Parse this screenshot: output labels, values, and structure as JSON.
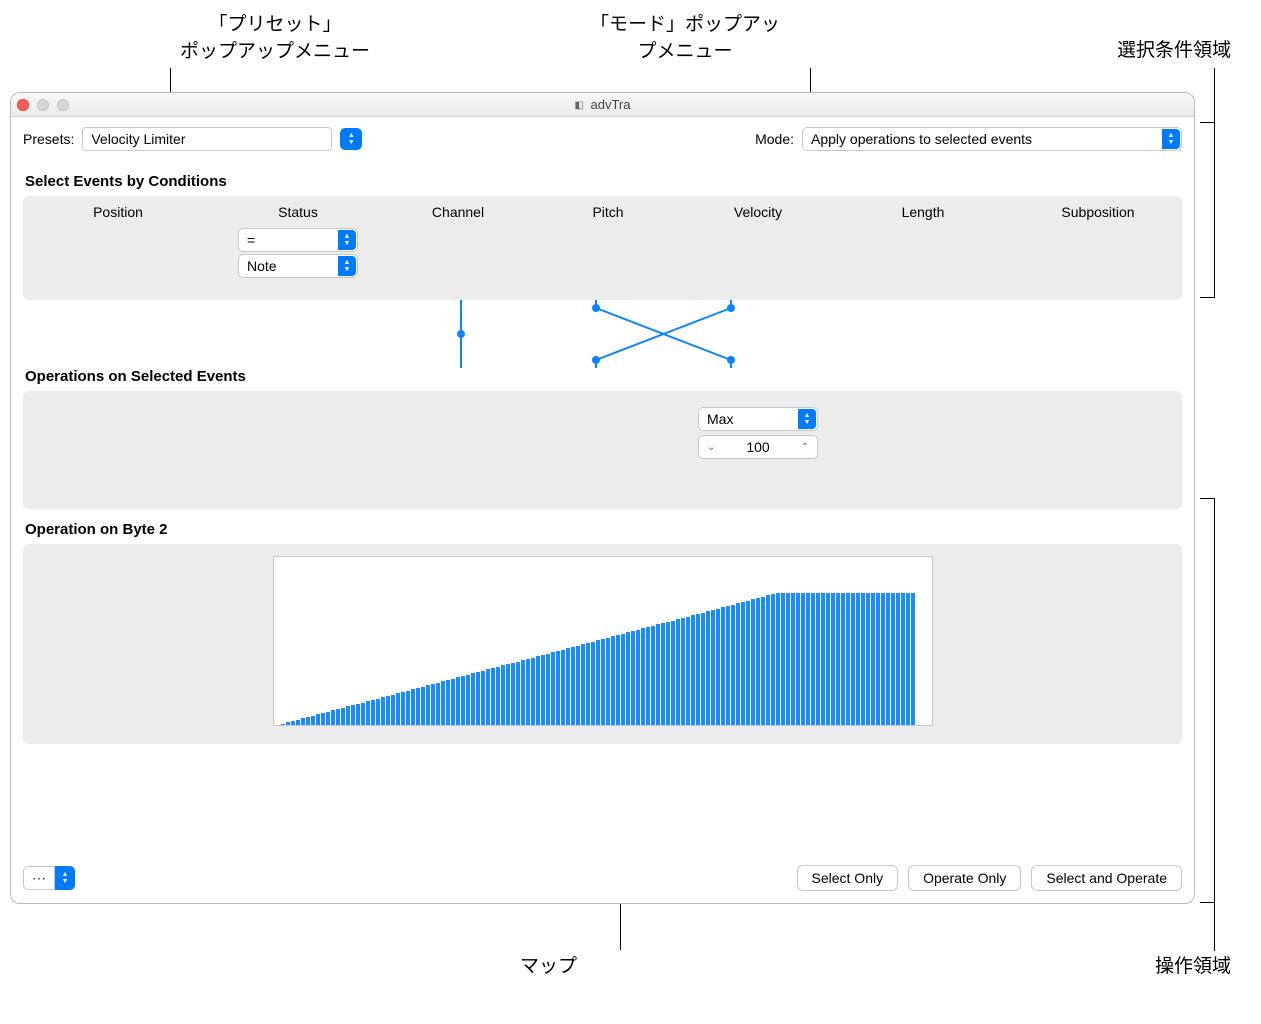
{
  "callouts": {
    "preset": "「プリセット」\nポップアップメニュー",
    "mode": "「モード」ポップアッ\nプメニュー",
    "select_area": "選択条件領域",
    "map": "マップ",
    "ops_area": "操作領域"
  },
  "window": {
    "title": "advTra"
  },
  "toolbar": {
    "presets_label": "Presets:",
    "presets_value": "Velocity Limiter",
    "mode_label": "Mode:",
    "mode_value": "Apply operations to selected events"
  },
  "sections": {
    "select_events": "Select Events by Conditions",
    "operations": "Operations on Selected Events",
    "byte2": "Operation on Byte 2"
  },
  "columns": {
    "position": "Position",
    "status": "Status",
    "channel": "Channel",
    "pitch": "Pitch",
    "velocity": "Velocity",
    "length": "Length",
    "subposition": "Subposition"
  },
  "conditions": {
    "status_op": "=",
    "status_val": "Note"
  },
  "operations": {
    "velocity_func": "Max",
    "velocity_value": "100"
  },
  "chart_data": {
    "type": "bar",
    "title": "",
    "xlabel": "",
    "ylabel": "",
    "x_range": [
      0,
      127
    ],
    "y_range": [
      0,
      127
    ],
    "description": "Velocity limiter map: output = min(input, 100)",
    "limit": 100,
    "series": [
      {
        "name": "Byte 2 map",
        "formula": "y = min(x, 100) for x in 0..127"
      }
    ]
  },
  "buttons": {
    "select_only": "Select Only",
    "operate_only": "Operate Only",
    "select_and_operate": "Select and Operate"
  }
}
